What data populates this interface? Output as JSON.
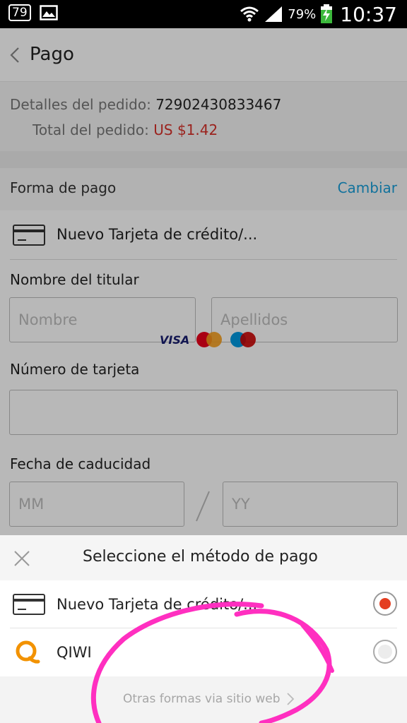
{
  "status_bar": {
    "notification_badge": "79",
    "battery_percent": "79%",
    "time": "10:37",
    "icons": [
      "image-icon",
      "wifi-icon",
      "signal-icon",
      "battery-charging-icon"
    ]
  },
  "app_bar": {
    "title": "Pago",
    "back_icon": "chevron-left-icon"
  },
  "order": {
    "details_label": "Detalles del pedido:",
    "details_value": "72902430833467",
    "total_label": "Total del pedido:",
    "total_value": "US $1.42"
  },
  "payment_method": {
    "title": "Forma de pago",
    "change_label": "Cambiar",
    "selected_card": "Nuevo Tarjeta de crédito/..."
  },
  "form": {
    "holder_label": "Nombre del titular",
    "first_name_placeholder": "Nombre",
    "last_name_placeholder": "Apellidos",
    "card_number_label": "Número de tarjeta",
    "card_logos": {
      "visa": "VISA",
      "mastercard": "MasterCard",
      "maestro": "Maestro"
    },
    "expiry_label": "Fecha de caducidad",
    "month_placeholder": "MM",
    "year_placeholder": "YY"
  },
  "sheet": {
    "title": "Seleccione el método de pago",
    "options": [
      {
        "label": "Nuevo Tarjeta de crédito/...",
        "selected": true,
        "icon": "credit-card-icon"
      },
      {
        "label": "QIWI",
        "selected": false,
        "icon": "qiwi-logo-icon"
      }
    ],
    "other_link": "Otras formas via sitio web"
  },
  "colors": {
    "accent_blue": "#1a9fd9",
    "price_red": "#d7312a",
    "radio_red": "#e43d20",
    "qiwi_orange": "#f29200",
    "marker_pink": "#ff2fc0"
  }
}
